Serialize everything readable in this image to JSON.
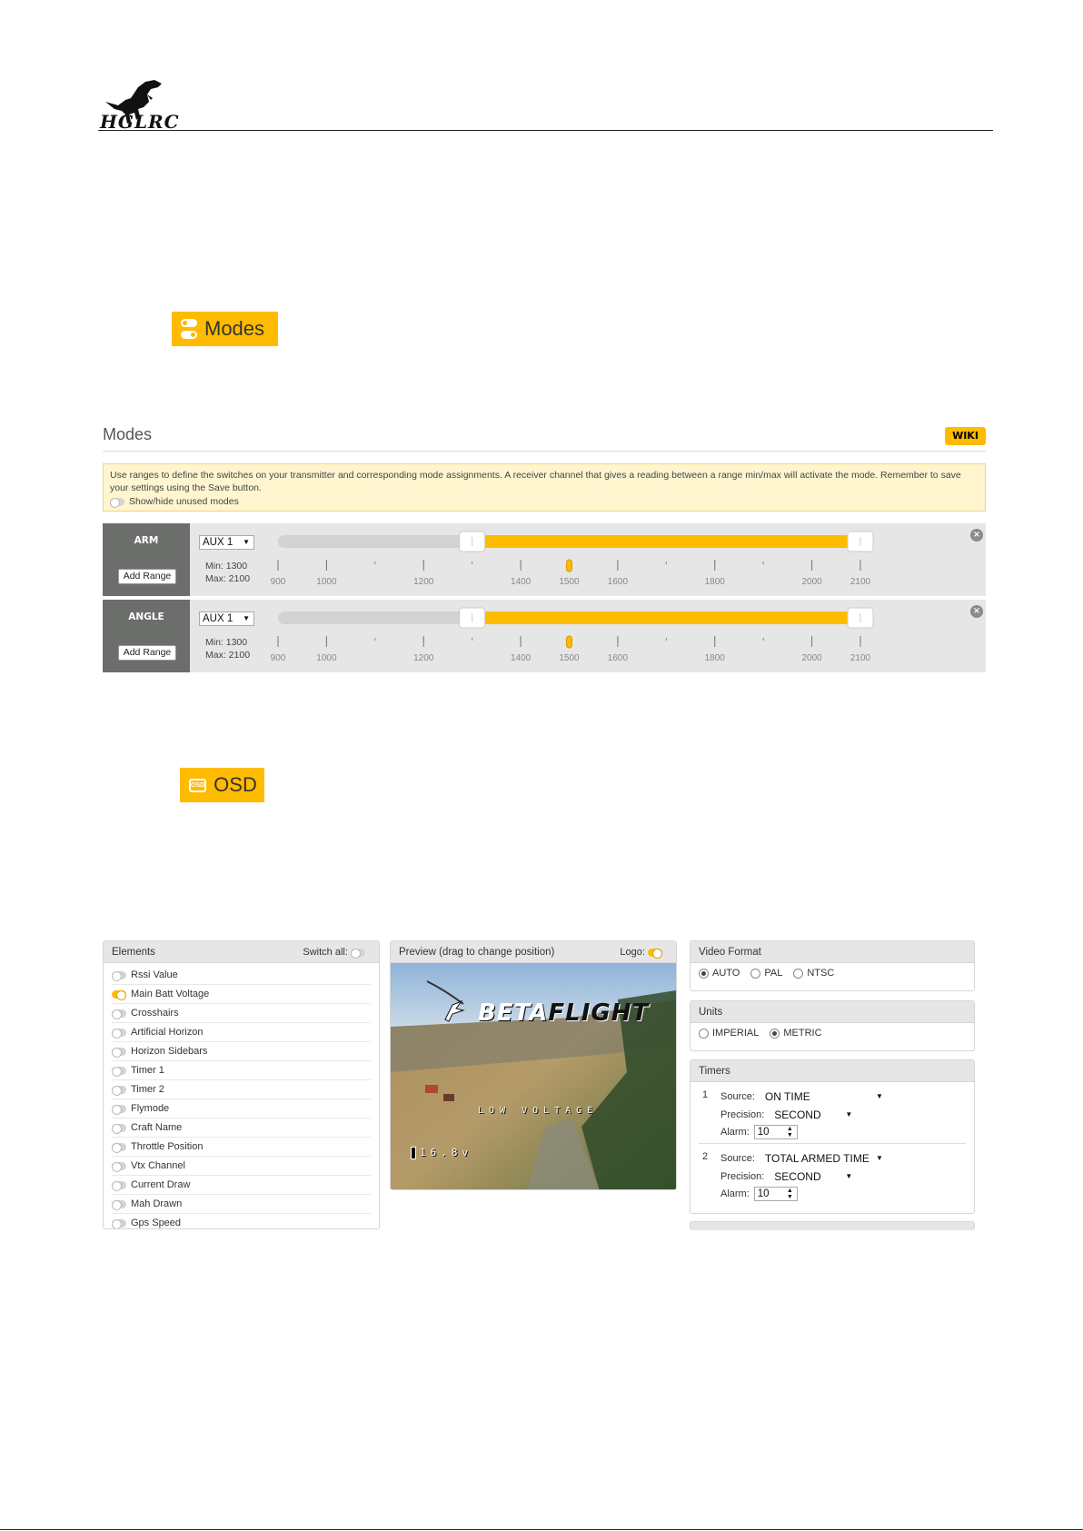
{
  "header": {
    "brand": "HGLRC"
  },
  "modes_tab": {
    "label": "Modes",
    "icon": "toggle-switch-icon"
  },
  "modes_panel": {
    "title": "Modes",
    "wiki_label": "WIKI",
    "note": "Use ranges to define the switches on your transmitter and corresponding mode assignments. A receiver channel that gives a reading between a range min/max will activate the mode. Remember to save your settings using the Save button.",
    "show_hide_label": "Show/hide unused modes",
    "scale_ticks": [
      "900",
      "1000",
      "1200",
      "1400",
      "1500",
      "1600",
      "1800",
      "2000",
      "2100"
    ],
    "modes": [
      {
        "name": "ARM",
        "channel": "AUX 1",
        "add_range": "Add Range",
        "min_label": "Min: 1300",
        "max_label": "Max: 2100",
        "range_min": 1300,
        "range_max": 2100,
        "current": 1500
      },
      {
        "name": "ANGLE",
        "channel": "AUX 1",
        "add_range": "Add Range",
        "min_label": "Min: 1300",
        "max_label": "Max: 2100",
        "range_min": 1300,
        "range_max": 2100,
        "current": 1500
      }
    ]
  },
  "osd_tab": {
    "label": "OSD",
    "icon_text": "OSD"
  },
  "osd": {
    "elements": {
      "title": "Elements",
      "switch_all": "Switch all:",
      "items": [
        {
          "label": "Rssi Value",
          "on": false
        },
        {
          "label": "Main Batt Voltage",
          "on": true
        },
        {
          "label": "Crosshairs",
          "on": false
        },
        {
          "label": "Artificial Horizon",
          "on": false
        },
        {
          "label": "Horizon Sidebars",
          "on": false
        },
        {
          "label": "Timer 1",
          "on": false
        },
        {
          "label": "Timer 2",
          "on": false
        },
        {
          "label": "Flymode",
          "on": false
        },
        {
          "label": "Craft Name",
          "on": false
        },
        {
          "label": "Throttle Position",
          "on": false
        },
        {
          "label": "Vtx Channel",
          "on": false
        },
        {
          "label": "Current Draw",
          "on": false
        },
        {
          "label": "Mah Drawn",
          "on": false
        },
        {
          "label": "Gps Speed",
          "on": false
        }
      ]
    },
    "preview": {
      "title": "Preview (drag to change position)",
      "logo_label": "Logo:",
      "logo_text_a": "BETA",
      "logo_text_b": "FLIGHT",
      "warning": "LOW VOLTAGE",
      "voltage": "16.8v"
    },
    "video_format": {
      "title": "Video Format",
      "options": [
        "AUTO",
        "PAL",
        "NTSC"
      ],
      "selected": "AUTO"
    },
    "units": {
      "title": "Units",
      "options": [
        "IMPERIAL",
        "METRIC"
      ],
      "selected": "METRIC"
    },
    "timers": {
      "title": "Timers",
      "source_label": "Source:",
      "precision_label": "Precision:",
      "alarm_label": "Alarm:",
      "items": [
        {
          "index": "1",
          "source": "ON TIME",
          "precision": "SECOND",
          "alarm": "10"
        },
        {
          "index": "2",
          "source": "TOTAL ARMED TIME",
          "precision": "SECOND",
          "alarm": "10"
        }
      ]
    }
  }
}
